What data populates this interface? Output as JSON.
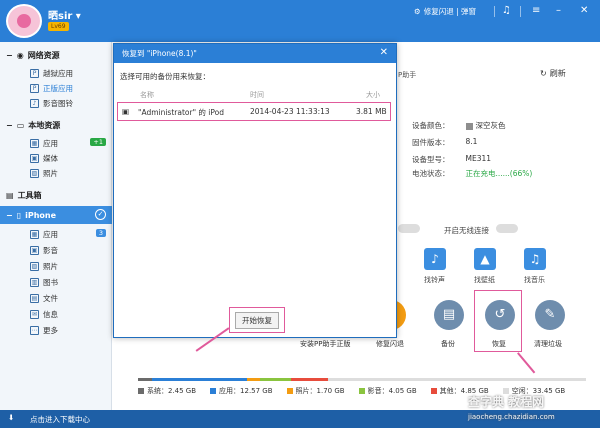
{
  "header": {
    "username": "晒sir",
    "level": "Lv69",
    "flash_label": "修复闪退 | 弹窗",
    "icons": [
      "music-note-icon",
      "menu-icon",
      "minimize-icon",
      "close-icon"
    ]
  },
  "sidebar": {
    "section_network": "网络资源",
    "network_items": [
      {
        "label": "越狱应用",
        "icon": "app-icon"
      },
      {
        "label": "正版应用",
        "icon": "app-icon"
      },
      {
        "label": "影音图铃",
        "icon": "music-icon"
      }
    ],
    "section_local": "本地资源",
    "local_items": [
      {
        "label": "应用",
        "badge": "+1"
      },
      {
        "label": "媒体"
      },
      {
        "label": "照片"
      }
    ],
    "section_tools": "工具箱",
    "section_iphone": "iPhone",
    "iphone_items": [
      {
        "label": "应用",
        "badge": "3"
      },
      {
        "label": "影音"
      },
      {
        "label": "照片"
      },
      {
        "label": "图书"
      },
      {
        "label": "文件"
      },
      {
        "label": "信息"
      },
      {
        "label": "更多"
      }
    ]
  },
  "main": {
    "title_partial": "P助手",
    "refresh": "刷新",
    "info": [
      {
        "k": "设备颜色：",
        "v": "深空灰色"
      },
      {
        "k": "固件版本：",
        "v": "8.1"
      },
      {
        "k": "设备型号：",
        "v": "ME311"
      },
      {
        "k": "电池状态：",
        "v": "正在充电......(66%)"
      }
    ],
    "wireless_label": "开启无线连接",
    "tiles": [
      "找铃声",
      "找壁纸",
      "找音乐"
    ],
    "actions": [
      "安装PP助手正版",
      "修复闪退",
      "备份",
      "恢复",
      "清理垃圾"
    ],
    "storage": [
      {
        "label": "系统：2.45 GB",
        "color": "#6b6b6b"
      },
      {
        "label": "应用：12.57 GB",
        "color": "#2b7fd6"
      },
      {
        "label": "照片：1.70 GB",
        "color": "#f39c12"
      },
      {
        "label": "影音：4.05 GB",
        "color": "#8ac43f"
      },
      {
        "label": "其他：4.85 GB",
        "color": "#e74c3c"
      },
      {
        "label": "空闲：33.45 GB",
        "color": "#dddddd"
      }
    ]
  },
  "dialog": {
    "title": "恢复到 \"iPhone(8.1)\"",
    "subtitle": "选择可用的备份用来恢复：",
    "col_name": "名称",
    "col_time": "时间",
    "col_size": "大小",
    "backup": {
      "name": "\"Administrator\" 的 iPod",
      "time": "2014-04-23 11:33:13",
      "size": "3.81 MB"
    },
    "start_button": "开始恢复"
  },
  "footer": {
    "download_center": "点击进入下载中心"
  },
  "watermark": {
    "main": "查字典 教程网",
    "url": "jiaocheng.chazidian.com"
  }
}
